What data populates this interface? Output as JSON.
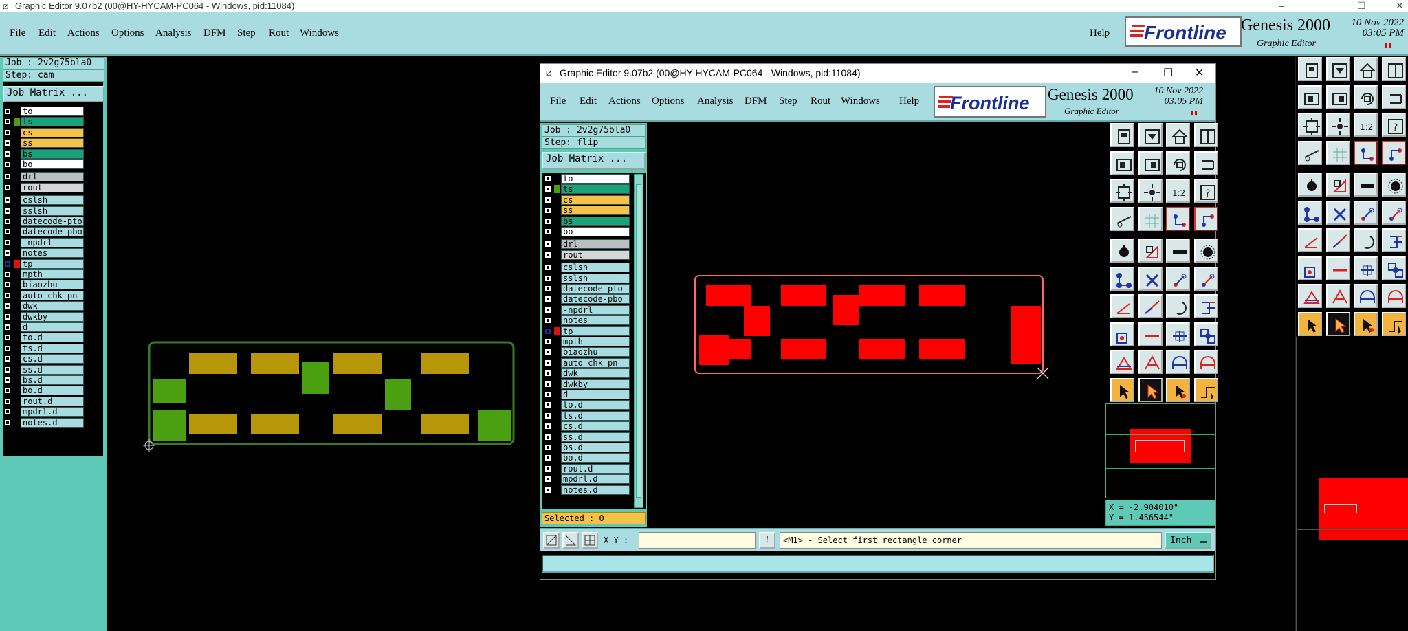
{
  "outer_window": {
    "title": "Graphic Editor 9.07b2 (00@HY-HYCAM-PC064 - Windows, pid:11084)",
    "controls": [
      "–",
      "☐",
      "✕"
    ]
  },
  "menubar": {
    "items": [
      "File",
      "Edit",
      "Actions",
      "Options",
      "Analysis",
      "DFM",
      "Step",
      "Rout",
      "Windows"
    ],
    "help": "Help"
  },
  "brand": {
    "logo": "Frontline",
    "product": "Genesis 2000",
    "subtitle": "Graphic Editor",
    "date": "10 Nov 2022",
    "time": "03:05 PM"
  },
  "left_panel": {
    "job": "Job : 2v2g75bla0",
    "step": "Step: cam",
    "job_matrix": "Job Matrix ...",
    "layers_board": [
      {
        "name": "to",
        "color": "#ffffff"
      },
      {
        "name": "ts",
        "color": "#1aa37a",
        "swatch": "#4aa010"
      },
      {
        "name": "cs",
        "color": "#f7c24a"
      },
      {
        "name": "ss",
        "color": "#f7c24a"
      },
      {
        "name": "bs",
        "color": "#1aa37a"
      },
      {
        "name": "bo",
        "color": "#ffffff"
      }
    ],
    "layers_drill": [
      {
        "name": "drl",
        "color": "#b8c0c4"
      },
      {
        "name": "rout",
        "color": "#d6d6d6"
      }
    ],
    "layers_misc": [
      {
        "name": "cslsh"
      },
      {
        "name": "sslsh"
      },
      {
        "name": "datecode-pto"
      },
      {
        "name": "datecode-pbo"
      },
      {
        "name": "-npdrl"
      },
      {
        "name": "notes"
      },
      {
        "name": "tp",
        "swatch": "#e01010",
        "selected": true
      },
      {
        "name": "mpth"
      },
      {
        "name": "biaozhu"
      },
      {
        "name": "auto_chk_pn"
      },
      {
        "name": "dwk"
      },
      {
        "name": "dwkby"
      },
      {
        "name": "d"
      },
      {
        "name": "to.d"
      },
      {
        "name": "ts.d"
      },
      {
        "name": "cs.d"
      },
      {
        "name": "ss.d"
      },
      {
        "name": "bs.d"
      },
      {
        "name": "bo.d"
      },
      {
        "name": "rout.d"
      },
      {
        "name": "mpdrl.d"
      },
      {
        "name": "notes.d"
      }
    ]
  },
  "inner_window": {
    "title": "Graphic Editor 9.07b2 (00@HY-HYCAM-PC064 - Windows, pid:11084)",
    "controls": [
      "–",
      "☐",
      "✕"
    ],
    "job": "Job : 2v2g75bla0",
    "step": "Step: flip",
    "job_matrix": "Job Matrix ...",
    "selected": "Selected : 0",
    "xy_label": "X Y :",
    "xy_value": "",
    "prompt": "<M1> - Select first rectangle corner",
    "units": "Inch",
    "coord_x": "X = -2.904010\"",
    "coord_y": "Y = 1.456544\""
  },
  "colors": {
    "menubar": "#a8dce0",
    "panel": "#5fc9b8",
    "pad_yellow": "#b8960a",
    "pad_green": "#4aa010",
    "pad_red": "#ff0000",
    "outline_green": "#3a7a2a",
    "outline_red": "#ff6666"
  }
}
